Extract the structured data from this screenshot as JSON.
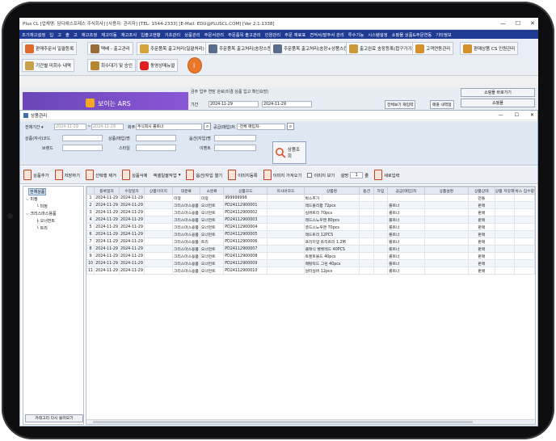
{
  "window": {
    "title": "Plus CL  [업체명: 담다에스프레스 주식회사] [사용자: 관리자] [TEL: 1544-2333] [E-Mail: EDU@PLUSCL.COM]  [Ver 2.1.1338]",
    "controls": [
      "—",
      "☐",
      "✕"
    ]
  },
  "menu": [
    "조기재고설정",
    "입",
    "고",
    "출",
    "고",
    "재고조정",
    "재고이동",
    "재고조사",
    "입출고현황",
    "기초관리",
    "상품관리",
    "주문서관리",
    "주문품목 출고관리",
    "인원관리",
    "주문 재료표",
    "견적서/발주서 관리",
    "투수기능",
    "시스템설정",
    "쇼핑몰 상품&주문연동",
    "기타정보"
  ],
  "toolbar_top": [
    "판매주문서 일괄등록",
    "택배 - 출고관리",
    "주문품목 출고처리(일괄처리)",
    "주문품목 출고처리(송장스캔)",
    "주문품목 출고처리(송장+상품스캔)",
    "출고완료 송장등록(합구가기)",
    "고객연동관리",
    "판매상품 CS 인원관리",
    "기간별 미회수 내역",
    "회수대기 및 승인",
    "동영상매뉴얼"
  ],
  "behind": {
    "banner_text": "보이는 ARS",
    "notice": "금주 업무 연장 완료(미결 상품 입고 확인요망)",
    "panel_title": "쇼핑몰 바로가기",
    "panel_sub": "쇼핑몰",
    "period_label": "기간",
    "date_from": "2024-11-29",
    "date_to": "2024-11-29",
    "buttons": [
      "전체보기 재입력",
      "매출 내역정"
    ]
  },
  "dialog": {
    "title": "상품관리",
    "controls": [
      "—",
      "☐",
      "✕"
    ]
  },
  "search": {
    "row1": {
      "period_label": "전체기간",
      "date_from": "2024-11-29",
      "date_to": "2024-11-29",
      "vendor_label": "화주",
      "vendor_value": "주식회사 롤트너",
      "supplier_label": "공급(매입)처",
      "supplier_value": "-전체 매입처-"
    },
    "labels": [
      "상품(자사)코드",
      "상품(매입)명",
      "옵션(자입)명",
      "브랜드",
      "스타일",
      "이벤트"
    ],
    "search_button": "상품조회"
  },
  "tools": [
    "상품추가",
    "저장하기",
    "선택행 제거",
    "상품삭제",
    "엑셀일괄작업",
    "옵션/자입 열기",
    "이미지등록",
    "이미지 가져오기",
    "이미지 보기",
    "설명",
    "새로입력"
  ],
  "tools_extra": {
    "checkbox_label": "이미지 보기",
    "page_label": "설명",
    "page_value": "1",
    "page_unit": "줄"
  },
  "tree": {
    "items": [
      "전체상품",
      "미정",
      "미정",
      "크리스마스용품",
      "오너먼트",
      "트리"
    ],
    "reload_button": "카테고리 다시 불러오기"
  },
  "grid": {
    "columns": [
      "",
      "등록일자",
      "수정일자",
      "상품이미지",
      "대분류",
      "소분류",
      "상품코드",
      "자사바코드",
      "상품명",
      "옵션",
      "차입",
      "공급(매입)처",
      "상품설명",
      "상품상태",
      "상품 저장해",
      "박스 입수량"
    ],
    "rows": [
      [
        "1",
        "2024-11-29",
        "2024-11-29",
        "",
        "미정",
        "미정",
        "999999999",
        "",
        "박스추가",
        "",
        "",
        "",
        "",
        "만들",
        "",
        ""
      ],
      [
        "2",
        "2024-11-29",
        "2024-11-29",
        "",
        "크리스마스용품",
        "오너먼트",
        "PD24112900001",
        "",
        "레드볼리팝 72pcs",
        "",
        "",
        "롤트너",
        "",
        "판매",
        "",
        ""
      ],
      [
        "3",
        "2024-11-29",
        "2024-11-29",
        "",
        "크리스마스용품",
        "오너먼트",
        "PD24112900002",
        "",
        "실버트리 70pcs",
        "",
        "",
        "롤트너",
        "",
        "판매",
        "",
        ""
      ],
      [
        "4",
        "2024-11-29",
        "2024-11-29",
        "",
        "크리스마스용품",
        "오너먼트",
        "PD24112900003",
        "",
        "레드스노우맨 80pcs",
        "",
        "",
        "롤트너",
        "",
        "판매",
        "",
        ""
      ],
      [
        "5",
        "2024-11-29",
        "2024-11-29",
        "",
        "크리스마스용품",
        "오너먼트",
        "PD24112900004",
        "",
        "골드스노우맨 70pcs",
        "",
        "",
        "롤트너",
        "",
        "판매",
        "",
        ""
      ],
      [
        "6",
        "2024-11-29",
        "2024-11-29",
        "",
        "크리스마스용품",
        "오너먼트",
        "PD24112900005",
        "",
        "레드트리 12PCS",
        "",
        "",
        "롤트너",
        "",
        "판매",
        "",
        ""
      ],
      [
        "7",
        "2024-11-29",
        "2024-11-29",
        "",
        "크리스마스용품",
        "트리",
        "PD24112900006",
        "",
        "프리미엄 트리트리 1.2M",
        "",
        "",
        "롤트너",
        "",
        "판매",
        "",
        ""
      ],
      [
        "8",
        "2024-11-29",
        "2024-11-29",
        "",
        "크리스마스용품",
        "오너먼트",
        "PD24112900007",
        "",
        "클래식 벨벳레드 40PCS",
        "",
        "",
        "롤트너",
        "",
        "판매",
        "",
        ""
      ],
      [
        "9",
        "2024-11-29",
        "2024-11-29",
        "",
        "크리스마스용품",
        "오너먼트",
        "PD24112900008",
        "",
        "트랜트볼드 40pcs",
        "",
        "",
        "롤트너",
        "",
        "판매",
        "",
        ""
      ],
      [
        "10",
        "2024-11-29",
        "2024-11-29",
        "",
        "크리스마스용품",
        "오너먼트",
        "PD24112900009",
        "",
        "메탈릭드 그린 40pcs",
        "",
        "",
        "롤트너",
        "",
        "판매",
        "",
        ""
      ],
      [
        "11",
        "2024-11-29",
        "2024-11-29",
        "",
        "크리스마스용품",
        "오너먼트",
        "PD24112900010",
        "",
        "원터실버 12pcs",
        "",
        "",
        "롤트너",
        "",
        "판매",
        "",
        ""
      ]
    ]
  },
  "colors": {
    "menubar": "#1f3a93",
    "accent_red": "#c73e1d",
    "dialog_border": "#9fb0c9",
    "banner": "#7a4fc8"
  }
}
